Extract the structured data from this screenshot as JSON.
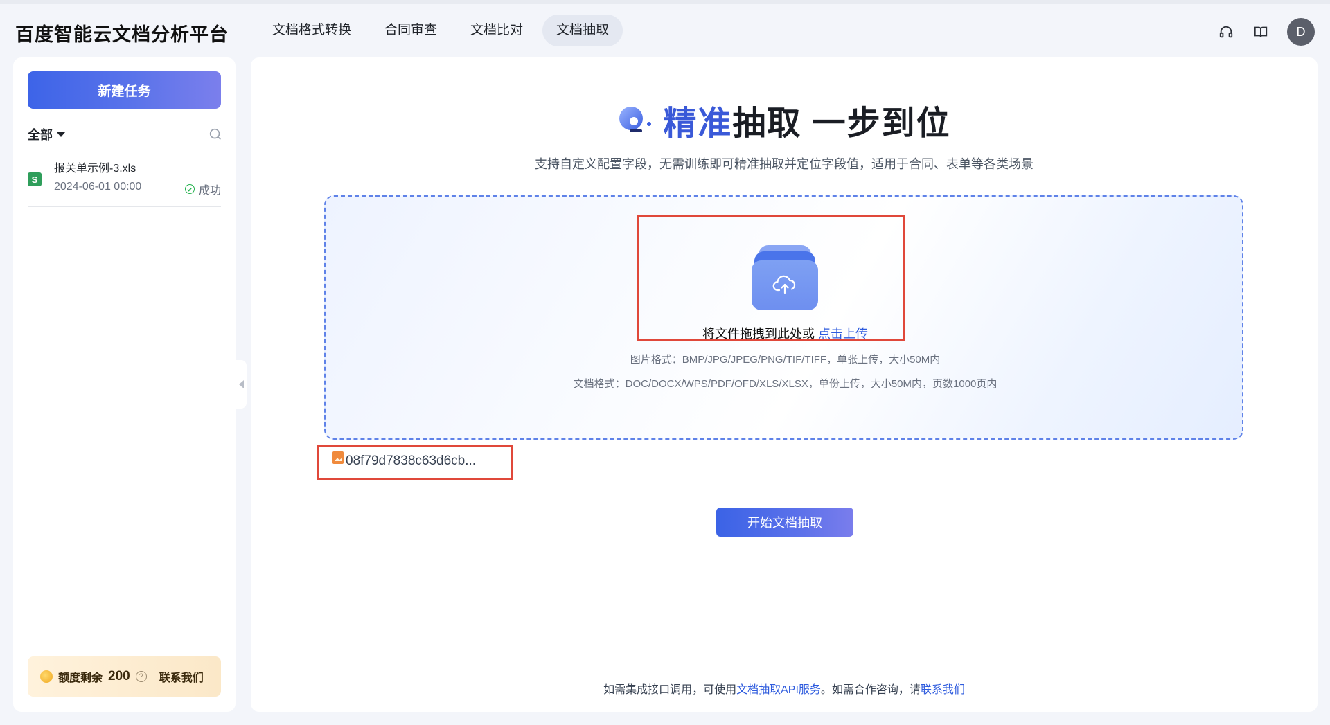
{
  "header": {
    "brand": "百度智能云文档分析平台",
    "nav": [
      "文档格式转换",
      "合同审查",
      "文档比对",
      "文档抽取"
    ],
    "active_nav": "文档抽取",
    "avatar_letter": "D"
  },
  "sidebar": {
    "new_task_label": "新建任务",
    "filter_label": "全部",
    "items": [
      {
        "name": "报关单示例-3.xls",
        "time": "2024-06-01 00:00",
        "status": "成功",
        "file_badge": "S"
      }
    ],
    "quota": {
      "label": "额度剩余",
      "value": "200",
      "help": "?",
      "contact": "联系我们"
    }
  },
  "main": {
    "hero_accent": "精准",
    "hero_rest": "抽取 一步到位",
    "subtitle": "支持自定义配置字段，无需训练即可精准抽取并定位字段值，适用于合同、表单等各类场景",
    "upload_text": "将文件拖拽到此处或 ",
    "upload_link": "点击上传",
    "image_formats": "图片格式：BMP/JPG/JPEG/PNG/TIF/TIFF，单张上传，大小50M内",
    "doc_formats": "文档格式：DOC/DOCX/WPS/PDF/OFD/XLS/XLSX，单份上传，大小50M内，页数1000页内",
    "uploaded_file": "08f79d7838c63d6cb...",
    "start_button": "开始文档抽取",
    "footer_prefix": "如需集成接口调用，可使用",
    "footer_link1": "文档抽取API服务",
    "footer_middle": "。如需合作咨询，请",
    "footer_link2": "联系我们"
  },
  "colors": {
    "accent": "#3a59d8",
    "highlight_box": "#e0483a",
    "success": "#22b14c"
  }
}
